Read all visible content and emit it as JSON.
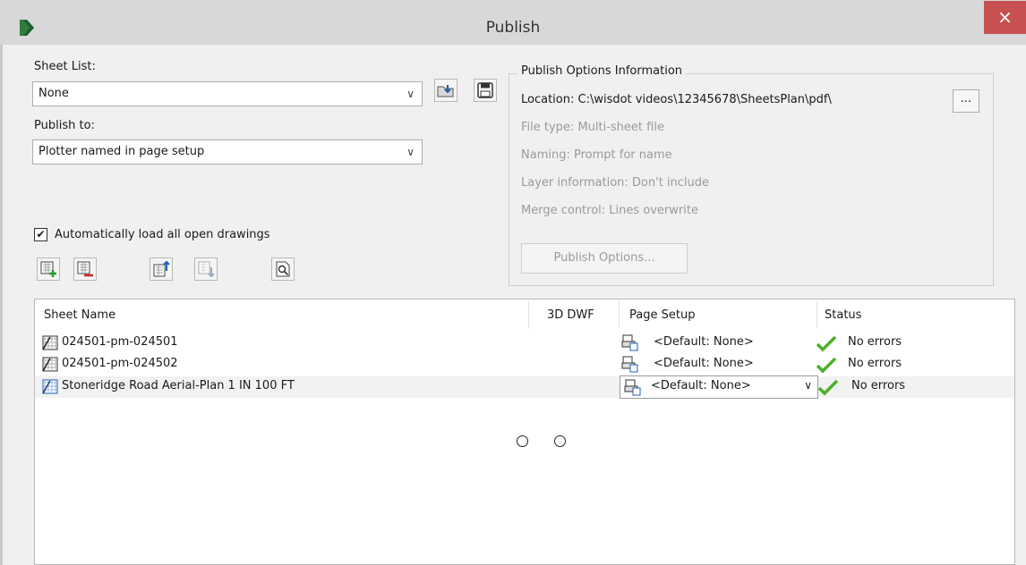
{
  "window": {
    "title": "Publish",
    "close_symbol": "×"
  },
  "sheet_list": {
    "label": "Sheet List:",
    "value": "None"
  },
  "publish_to": {
    "label": "Publish to:",
    "value": "Plotter named in page setup"
  },
  "options_info": {
    "title": "Publish Options Information",
    "location": "Location: C:\\wisdot videos\\12345678\\SheetsPlan\\pdf\\",
    "browse_label": "...",
    "file_type": "File type: Multi-sheet file",
    "naming": "Naming: Prompt for name",
    "layer_info": "Layer information: Don't include",
    "merge_control": "Merge control: Lines overwrite",
    "publish_options_button": "Publish Options..."
  },
  "auto_load": {
    "label": "Automatically load all open drawings",
    "checked": true,
    "check_symbol": "✔"
  },
  "icons": {
    "app": "autocad-app-icon",
    "load_list": "load-sheet-list-icon",
    "save_list": "save-sheet-list-icon",
    "add_sheets": "add-sheets-icon",
    "remove_sheets": "remove-sheets-icon",
    "move_up": "move-sheet-up-icon",
    "move_down": "move-sheet-down-icon",
    "preview": "preview-icon"
  },
  "table": {
    "columns": [
      "Sheet Name",
      "3D DWF",
      "Page Setup",
      "Status"
    ],
    "rows": [
      {
        "name": "024501-pm-024501",
        "dwf": "",
        "page_setup": "<Default: None>",
        "status": "No errors"
      },
      {
        "name": "024501-pm-024502",
        "dwf": "",
        "page_setup": "<Default: None>",
        "status": "No errors"
      },
      {
        "name": "Stoneridge Road Aerial-Plan 1 IN 100 FT",
        "dwf": "",
        "page_setup": "<Default: None>",
        "status": "No errors"
      }
    ]
  },
  "colors": {
    "close": "#c75050",
    "check": "#4caf2a",
    "title_bar": "#d8d8d8"
  }
}
